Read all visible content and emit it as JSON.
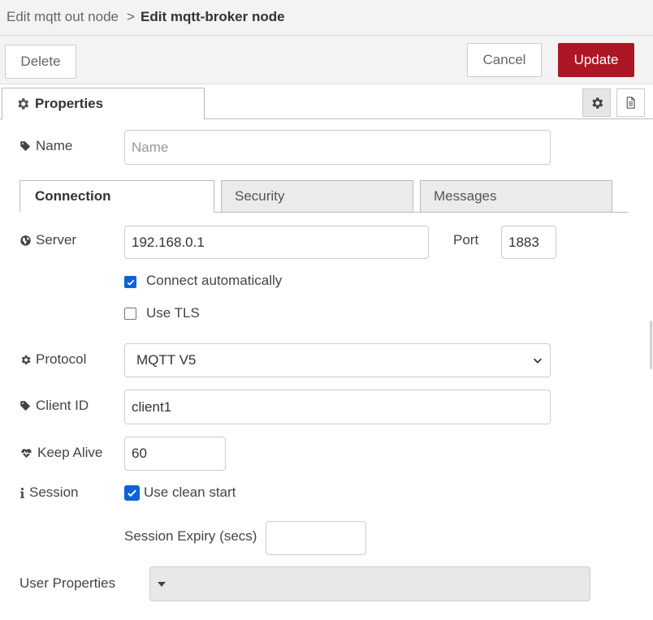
{
  "breadcrumb": {
    "previous": "Edit mqtt out node",
    "separator": ">",
    "current": "Edit mqtt-broker node"
  },
  "toolbar": {
    "delete_label": "Delete",
    "cancel_label": "Cancel",
    "update_label": "Update",
    "update_color": "#ad1625"
  },
  "properties_tab": {
    "label": "Properties",
    "icon": "gear-icon"
  },
  "name_field": {
    "label": "Name",
    "placeholder": "Name",
    "value": ""
  },
  "subtabs": [
    {
      "label": "Connection",
      "active": true
    },
    {
      "label": "Security",
      "active": false
    },
    {
      "label": "Messages",
      "active": false
    }
  ],
  "connection": {
    "server_label": "Server",
    "server_value": "192.168.0.1",
    "port_label": "Port",
    "port_value": "1883",
    "connect_auto_label": "Connect automatically",
    "connect_auto_checked": true,
    "use_tls_label": "Use TLS",
    "use_tls_checked": false,
    "protocol_label": "Protocol",
    "protocol_value": "MQTT V5",
    "client_id_label": "Client ID",
    "client_id_value": "client1",
    "keep_alive_label": "Keep Alive",
    "keep_alive_value": "60",
    "session_label": "Session",
    "clean_start_label": "Use clean start",
    "clean_start_checked": true,
    "session_expiry_label": "Session Expiry (secs)",
    "session_expiry_value": "",
    "user_properties_label": "User Properties"
  }
}
